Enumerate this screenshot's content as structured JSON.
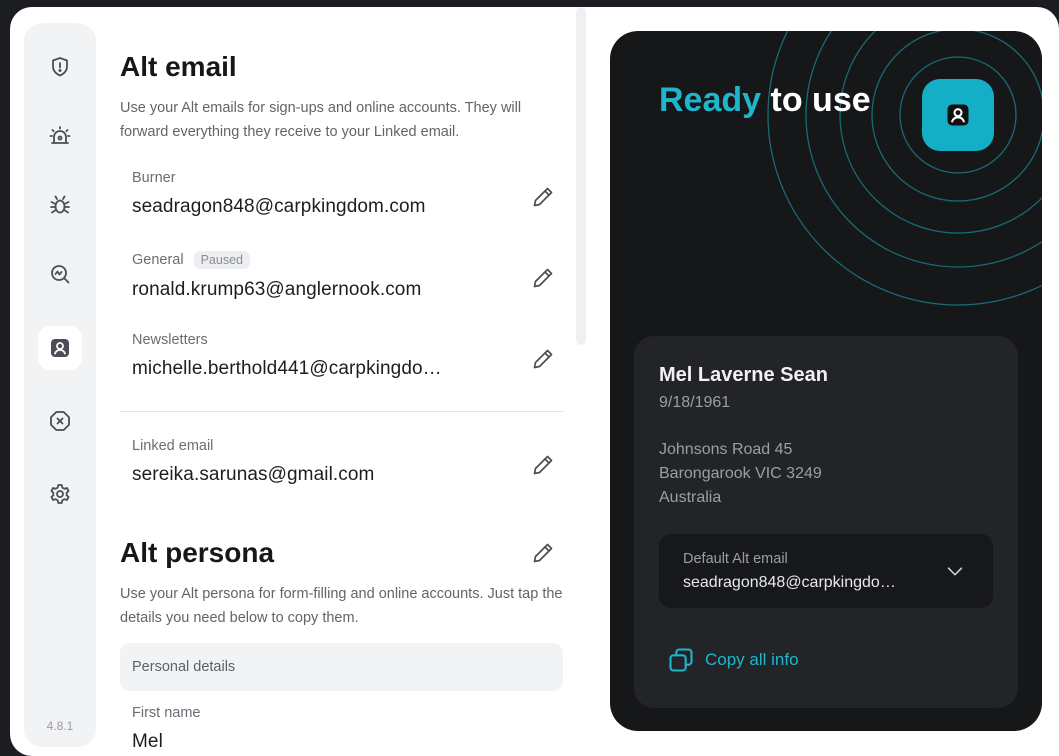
{
  "sidebar": {
    "items": [
      {
        "icon": "shield-icon",
        "active": false
      },
      {
        "icon": "alarm-light-icon",
        "active": false
      },
      {
        "icon": "bug-icon",
        "active": false
      },
      {
        "icon": "search-monitor-icon",
        "active": false
      },
      {
        "icon": "persona-icon",
        "active": true
      },
      {
        "icon": "blocked-icon",
        "active": false
      },
      {
        "icon": "settings-icon",
        "active": false
      }
    ],
    "version": "4.8.1"
  },
  "alt_email": {
    "title": "Alt email",
    "description": "Use your Alt emails for sign-ups and online accounts. They will forward everything they receive to your Linked email.",
    "entries": [
      {
        "label": "Burner",
        "badge": "",
        "value": "seadragon848@carpkingdom.com"
      },
      {
        "label": "General",
        "badge": "Paused",
        "value": "ronald.krump63@anglernook.com"
      },
      {
        "label": "Newsletters",
        "badge": "",
        "value": "michelle.berthold441@carpkingdo…"
      }
    ],
    "linked": {
      "label": "Linked email",
      "value": "sereika.sarunas@gmail.com"
    }
  },
  "alt_persona": {
    "title": "Alt persona",
    "description": "Use your Alt persona for form-filling and online accounts. Just tap the details you need below to copy them.",
    "section": "Personal details",
    "first_name": {
      "label": "First name",
      "value": "Mel"
    }
  },
  "card": {
    "ready_accent": "Ready",
    "ready_rest": " to use",
    "name": "Mel Laverne Sean",
    "dob": "9/18/1961",
    "address_line1": "Johnsons Road 45",
    "address_line2": "Barongarook VIC 3249",
    "address_line3": "Australia",
    "default_label": "Default Alt email",
    "default_value": "seadragon848@carpkingdo…",
    "copy_label": "Copy all info"
  },
  "colors": {
    "accent": "#1fb6cc",
    "card_bg": "#161719",
    "sidebar_bg": "#f2f3f5"
  }
}
